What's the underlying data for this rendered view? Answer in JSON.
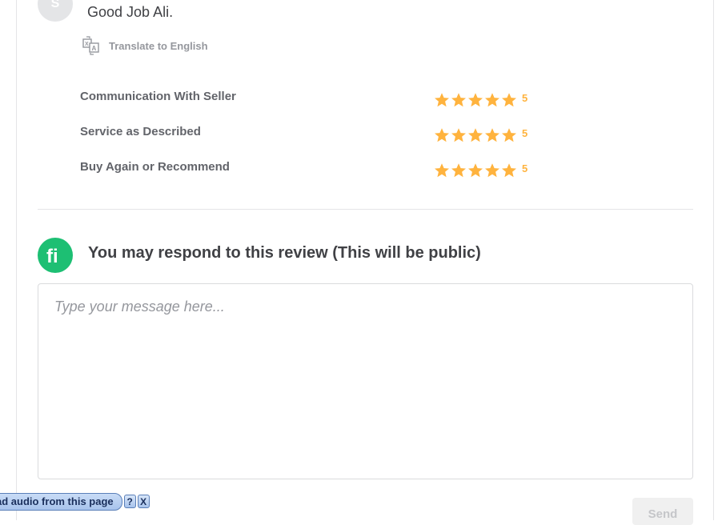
{
  "review": {
    "avatar_initial": "S",
    "text": "Good Job Ali.",
    "translate_label": "Translate to English"
  },
  "ratings": [
    {
      "label": "Communication With Seller",
      "value": "5",
      "stars": 5
    },
    {
      "label": "Service as Described",
      "value": "5",
      "stars": 5
    },
    {
      "label": "Buy Again or Recommend",
      "value": "5",
      "stars": 5
    }
  ],
  "response": {
    "logo_text": "fi",
    "title": "You may respond to this review (This will be public)",
    "placeholder": "Type your message here...",
    "value": "",
    "send_label": "Send"
  },
  "audio_toolbar": {
    "label": "ad audio from this page",
    "help_label": "?",
    "close_label": "X"
  },
  "colors": {
    "brand": "#1dbf73",
    "star": "#ffb33e",
    "text": "#404145",
    "muted": "#95979d",
    "border": "#e4e5e7"
  }
}
